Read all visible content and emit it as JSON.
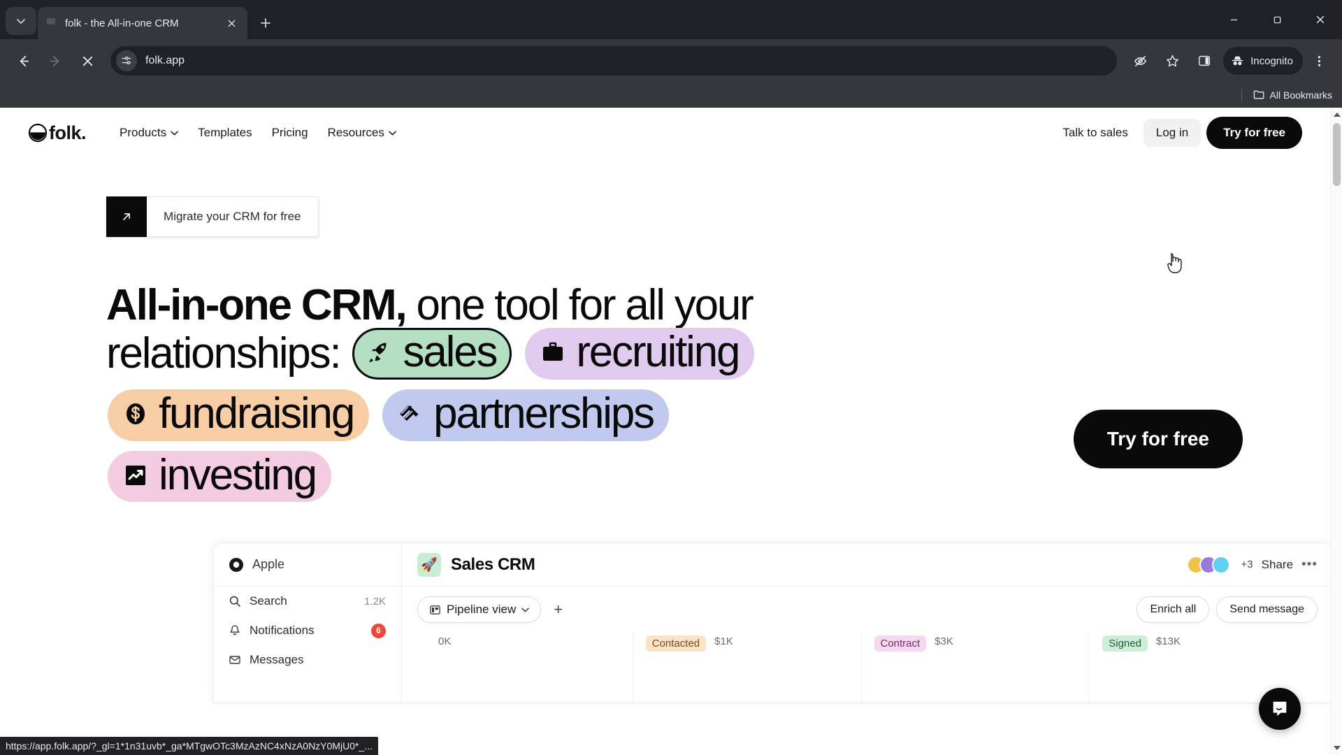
{
  "browser": {
    "tab": {
      "title": "folk - the All-in-one CRM",
      "close_label": "×"
    },
    "new_tab_label": "+",
    "window": {
      "minimize": "–",
      "maximize": "❐",
      "close": "✕"
    },
    "nav": {
      "back": "back-arrow",
      "forward": "forward-arrow",
      "stop": "✕"
    },
    "omnibox": {
      "url": "folk.app",
      "site_info_icon": "page-settings-icon"
    },
    "actions": {
      "tracking_protection": "eye-off-icon",
      "bookmark": "star-icon",
      "side_panel": "side-panel-icon",
      "incognito_label": "Incognito",
      "menu": "three-dot-menu-icon"
    },
    "bookmarks": {
      "all_bookmarks": "All Bookmarks"
    },
    "status_url": "https://app.folk.app/?_gl=1*1n31uvb*_ga*MTgwOTc3MzAzNC4xNzA0NzY0MjU0*_..."
  },
  "site": {
    "logo_text": "folk.",
    "nav_links": [
      {
        "label": "Products",
        "has_chevron": true
      },
      {
        "label": "Templates",
        "has_chevron": false
      },
      {
        "label": "Pricing",
        "has_chevron": false
      },
      {
        "label": "Resources",
        "has_chevron": true
      }
    ],
    "talk_to_sales": "Talk to sales",
    "log_in": "Log in",
    "try_for_free_nav": "Try for free"
  },
  "hero": {
    "migrate_banner": "Migrate your CRM for free",
    "headline_bold": "All-in-one CRM,",
    "headline_rest": " one tool for all your relationships:",
    "cta": "Try for free",
    "tags": [
      {
        "label": "sales",
        "icon": "rocket-icon",
        "bg": "#b5dfc2",
        "selected": true
      },
      {
        "label": "recruiting",
        "icon": "briefcase-icon",
        "bg": "#e0cbef",
        "selected": false
      },
      {
        "label": "fundraising",
        "icon": "dollar-coin-icon",
        "bg": "#f7cda6",
        "selected": false
      },
      {
        "label": "partnerships",
        "icon": "handshake-icon",
        "bg": "#c2c9ef",
        "selected": false
      },
      {
        "label": "investing",
        "icon": "trending-up-icon",
        "bg": "#f4cce2",
        "selected": false
      }
    ]
  },
  "app_preview": {
    "workspace": "Apple",
    "sidebar": [
      {
        "label": "Search",
        "icon": "search-icon",
        "count": "1.2K",
        "badge": null
      },
      {
        "label": "Notifications",
        "icon": "bell-icon",
        "count": null,
        "badge": "6"
      },
      {
        "label": "Messages",
        "icon": "envelope-icon",
        "count": null,
        "badge": null
      }
    ],
    "title": "Sales CRM",
    "title_icon": "rocket-icon",
    "extra_members": "+3",
    "share": "Share",
    "more": "•••",
    "view_selector": "Pipeline view",
    "add_view": "+",
    "enrich_all": "Enrich all",
    "send_message": "Send message",
    "pipeline": [
      {
        "stage": "",
        "amount": "0K",
        "tag_bg": "#ffffff",
        "tag_fg": "#6a6a6a"
      },
      {
        "stage": "Contacted",
        "amount": "$1K",
        "tag_bg": "#fce3c8",
        "tag_fg": "#7a4a1a"
      },
      {
        "stage": "Contract",
        "amount": "$3K",
        "tag_bg": "#f6d9ef",
        "tag_fg": "#7a2a66"
      },
      {
        "stage": "Signed",
        "amount": "$13K",
        "tag_bg": "#cdeed8",
        "tag_fg": "#1e5c35"
      }
    ]
  },
  "widgets": {
    "intercom": "chat-bubble-icon"
  }
}
